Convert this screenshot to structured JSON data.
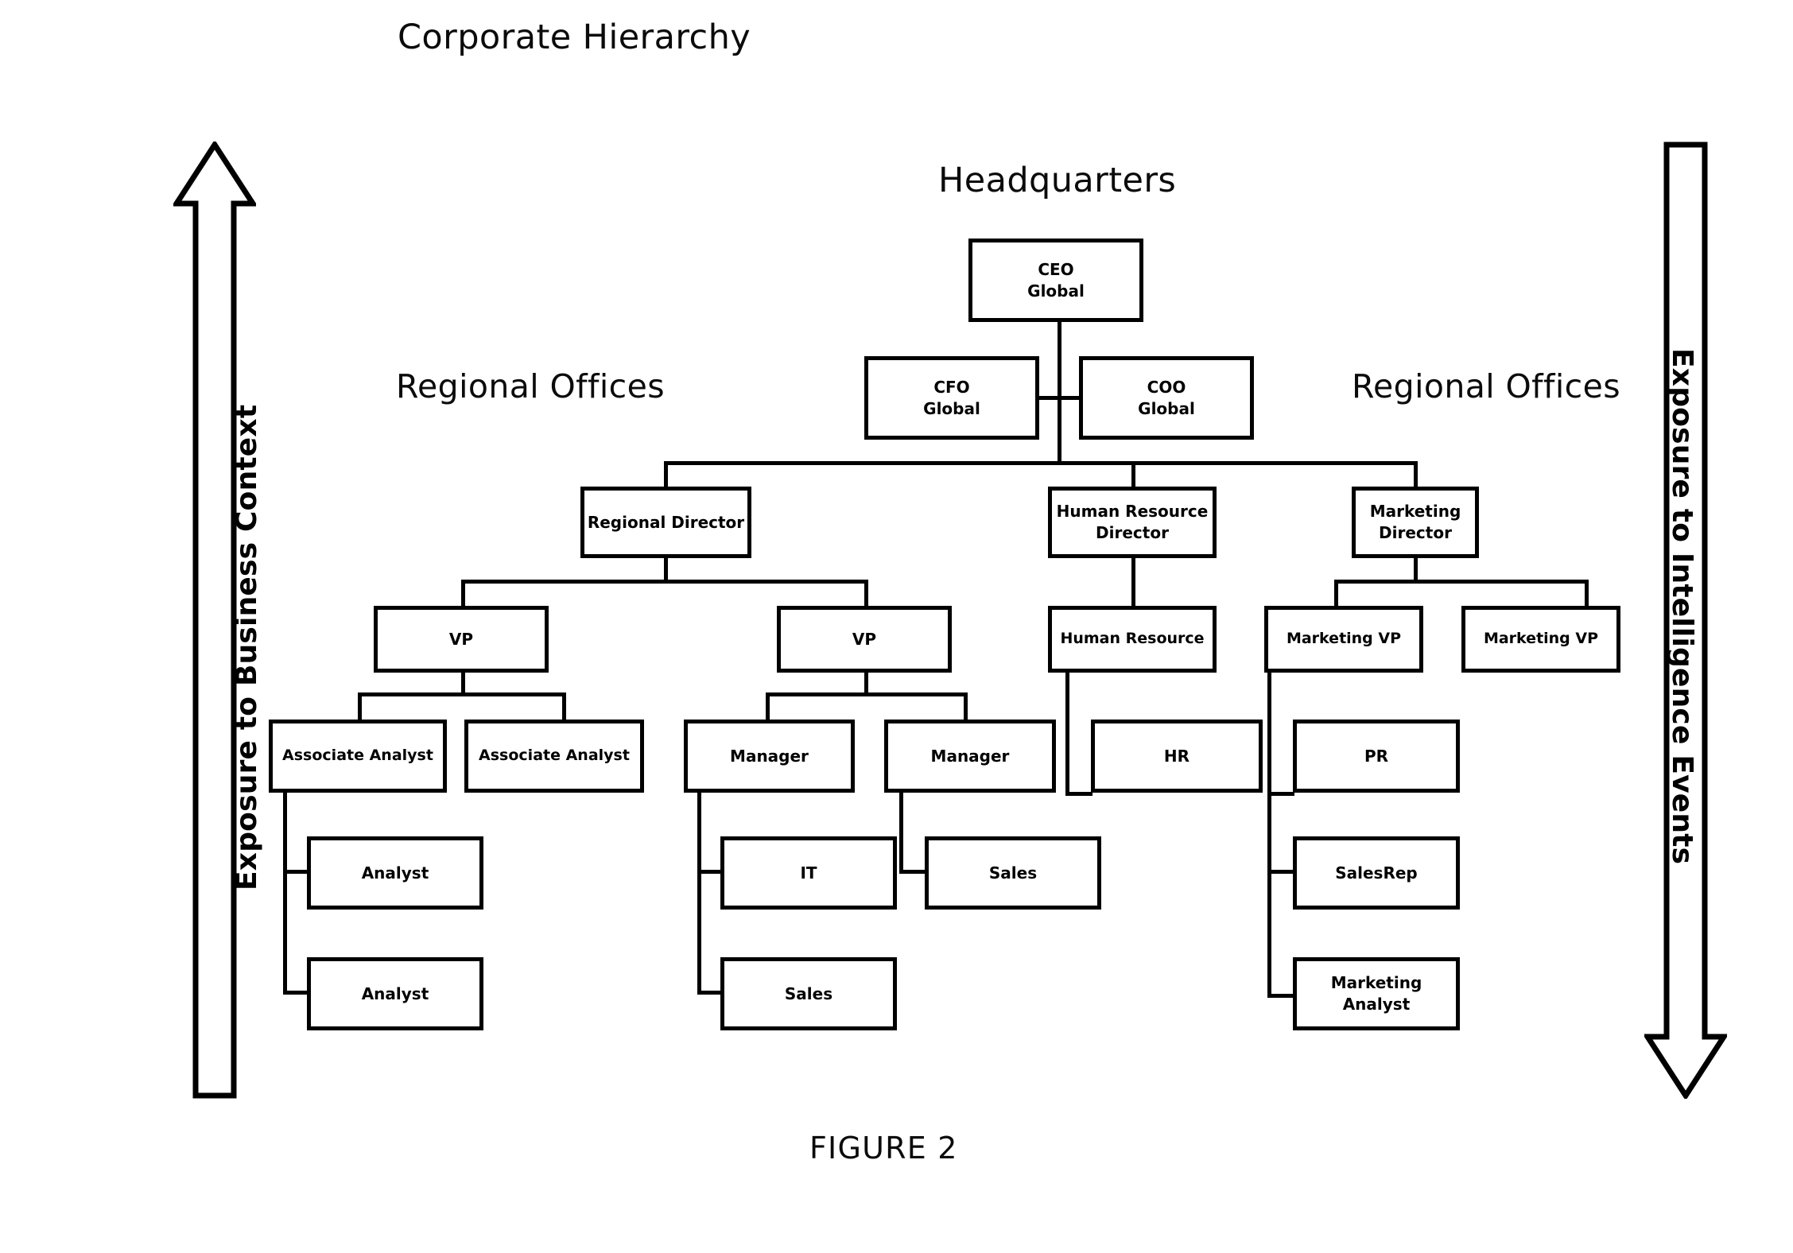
{
  "figure": {
    "title": "Corporate Hierarchy",
    "caption": "FIGURE 2"
  },
  "section_labels": {
    "headquarters": "Headquarters",
    "regional_offices_left": "Regional Offices",
    "regional_offices_right": "Regional Offices"
  },
  "axes": {
    "left_arrow": {
      "label": "Exposure to Business Context",
      "direction": "up"
    },
    "right_arrow": {
      "label": "Exposure to Intelligence Events",
      "direction": "down"
    }
  },
  "colors": {
    "box_fill": "#ffffff",
    "box_stroke": "#000000",
    "connector": "#000000",
    "text": "#000000",
    "background": "#ffffff"
  },
  "nodes": {
    "ceo": "CEO\nGlobal",
    "cfo": "CFO\nGlobal",
    "coo": "COO\nGlobal",
    "regional_director": "Regional Director",
    "hr_director": "Human Resource\nDirector",
    "marketing_director": "Marketing\nDirector",
    "vp_1": "VP",
    "vp_2": "VP",
    "human_resource": "Human Resource",
    "marketing_vp_1": "Marketing VP",
    "marketing_vp_2": "Marketing VP",
    "associate_analyst_1": "Associate Analyst",
    "associate_analyst_2": "Associate Analyst",
    "manager_1": "Manager",
    "manager_2": "Manager",
    "hr": "HR",
    "pr": "PR",
    "analyst_1": "Analyst",
    "analyst_2": "Analyst",
    "it": "IT",
    "sales_1": "Sales",
    "sales_2": "Sales",
    "sales_rep": "SalesRep",
    "marketing_analyst": "Marketing\nAnalyst"
  },
  "hierarchy": [
    {
      "parent": "ceo",
      "children": [
        "cfo",
        "coo"
      ]
    },
    {
      "parent": "coo",
      "children": [
        "regional_director",
        "hr_director",
        "marketing_director"
      ]
    },
    {
      "parent": "regional_director",
      "children": [
        "vp_1",
        "vp_2"
      ]
    },
    {
      "parent": "vp_1",
      "children": [
        "associate_analyst_1",
        "associate_analyst_2"
      ]
    },
    {
      "parent": "vp_2",
      "children": [
        "manager_1",
        "manager_2"
      ]
    },
    {
      "parent": "associate_analyst_1",
      "children": [
        "analyst_1",
        "analyst_2"
      ]
    },
    {
      "parent": "manager_1",
      "children": [
        "it",
        "sales_2"
      ]
    },
    {
      "parent": "manager_2",
      "children": [
        "sales_1"
      ]
    },
    {
      "parent": "hr_director",
      "children": [
        "human_resource"
      ]
    },
    {
      "parent": "human_resource",
      "children": [
        "hr"
      ]
    },
    {
      "parent": "marketing_director",
      "children": [
        "marketing_vp_1",
        "marketing_vp_2"
      ]
    },
    {
      "parent": "marketing_vp_1",
      "children": [
        "pr",
        "sales_rep",
        "marketing_analyst"
      ]
    }
  ]
}
